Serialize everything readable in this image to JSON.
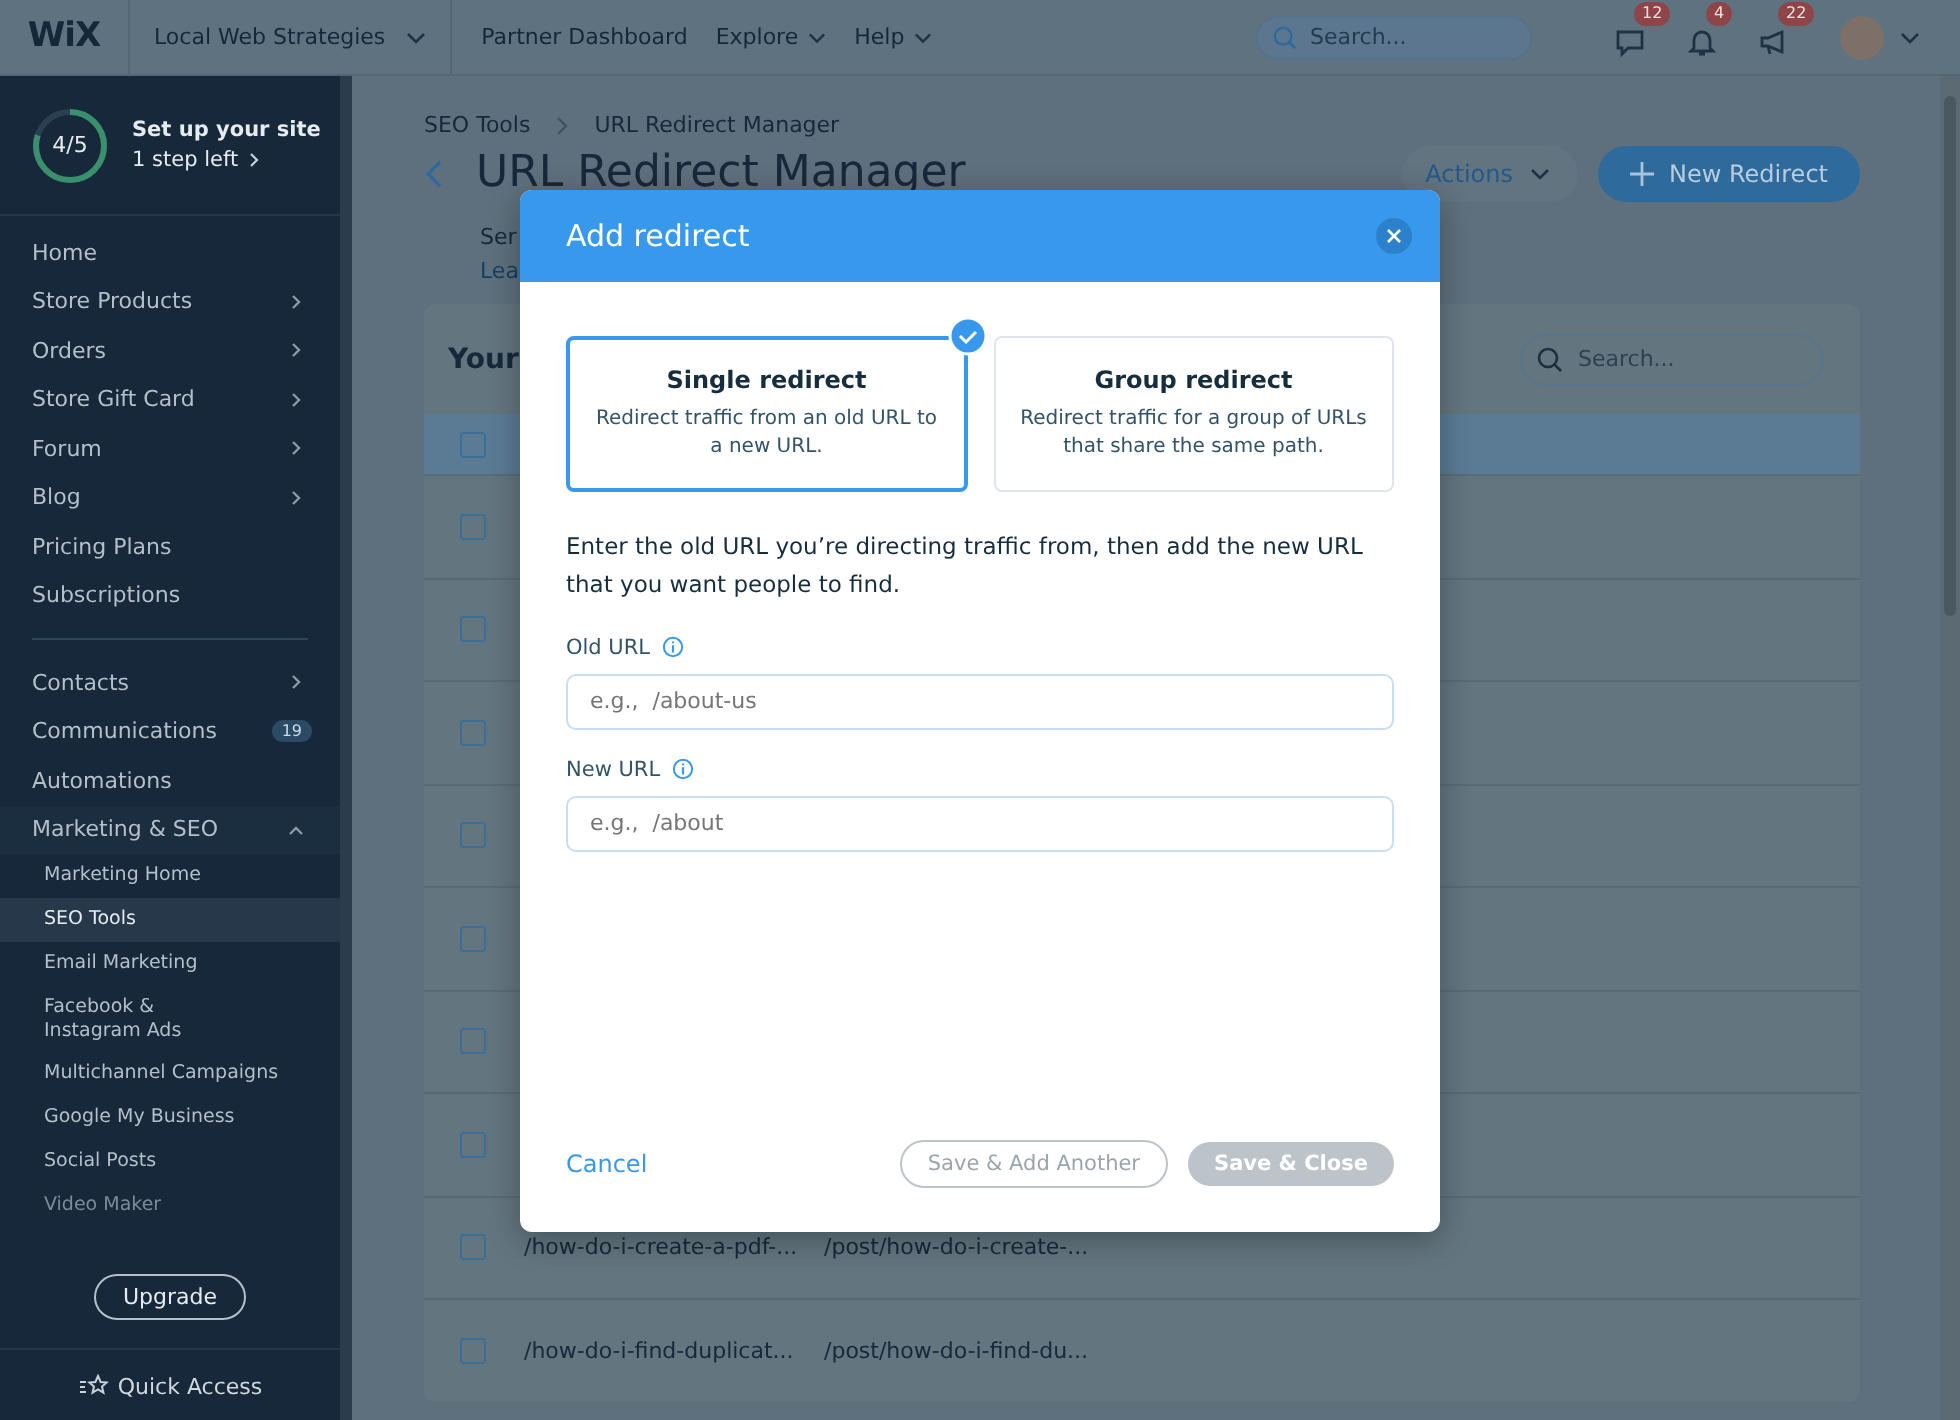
{
  "topbar": {
    "logo": "WiX",
    "site": "Local Web Strategies",
    "links": [
      {
        "label": "Partner Dashboard",
        "dropdown": false
      },
      {
        "label": "Explore",
        "dropdown": true
      },
      {
        "label": "Help",
        "dropdown": true
      }
    ],
    "search": {
      "placeholder": "Search..."
    },
    "notifications": [
      {
        "kind": "chat",
        "count": "12"
      },
      {
        "kind": "bell",
        "count": "4"
      },
      {
        "kind": "megaphone",
        "count": "22"
      }
    ]
  },
  "sidebar": {
    "setup": {
      "level": 0.8,
      "progress": "4/5",
      "title": "Set up your site",
      "subtitle": "1 step left"
    },
    "groups": [
      [
        {
          "label": "Home",
          "arrow": false
        },
        {
          "label": "Store Products",
          "arrow": true
        },
        {
          "label": "Orders",
          "arrow": true
        },
        {
          "label": "Store Gift Card",
          "arrow": true
        },
        {
          "label": "Forum",
          "arrow": true
        },
        {
          "label": "Blog",
          "arrow": true
        },
        {
          "label": "Pricing Plans",
          "arrow": false
        },
        {
          "label": "Subscriptions",
          "arrow": false
        }
      ],
      [
        {
          "label": "Contacts",
          "arrow": true
        },
        {
          "label": "Communications",
          "arrow": false,
          "badge": "19"
        },
        {
          "label": "Automations",
          "arrow": false
        },
        {
          "label": "Marketing & SEO",
          "arrow": true,
          "expanded": true,
          "children": [
            {
              "label": "Marketing Home",
              "selected": false
            },
            {
              "label": "SEO Tools",
              "selected": true
            },
            {
              "label": "Email Marketing",
              "selected": false
            },
            {
              "label": "Facebook &\nInstagram Ads",
              "selected": false
            },
            {
              "label": "Multichannel Campaigns",
              "selected": false
            },
            {
              "label": "Google My Business",
              "selected": false
            },
            {
              "label": "Social Posts",
              "selected": false
            },
            {
              "label": "Video Maker",
              "selected": false
            }
          ]
        }
      ]
    ],
    "upgrade": "Upgrade",
    "quick_access": "Quick Access"
  },
  "page": {
    "breadcrumbs": [
      "SEO Tools",
      "URL Redirect Manager"
    ],
    "title": "URL Redirect Manager",
    "subtitle": "Ser",
    "link": "Lea",
    "actions": "Actions",
    "new_button": "New Redirect",
    "table": {
      "title": "Your",
      "search": {
        "placeholder": "Search..."
      },
      "header": {
        "checked": false
      },
      "rows": [
        {
          "checked": false
        },
        {
          "checked": false
        },
        {
          "checked": false
        },
        {
          "checked": false
        },
        {
          "checked": false
        },
        {
          "checked": false
        },
        {
          "checked": false
        },
        {
          "checked": false,
          "from": "/how-do-i-create-a-pdf-...",
          "to": "/post/how-do-i-create-..."
        },
        {
          "checked": false,
          "from": "/how-do-i-find-duplicat...",
          "to": "/post/how-do-i-find-du..."
        }
      ]
    }
  },
  "modal": {
    "title": "Add redirect",
    "options": [
      {
        "title": "Single redirect",
        "description": "Redirect traffic from an old URL to a new URL.",
        "selected": true
      },
      {
        "title": "Group redirect",
        "description": "Redirect traffic for a group of URLs that share the same path.",
        "selected": false
      }
    ],
    "instructions": "Enter the old URL you’re directing traffic from, then add the new URL that you want people to find.",
    "fields": [
      {
        "label": "Old URL",
        "placeholder": "e.g.,  /about-us"
      },
      {
        "label": "New URL",
        "placeholder": "e.g.,  /about"
      }
    ],
    "cancel": "Cancel",
    "buttons": [
      {
        "label": "Save & Add Another",
        "kind": "outline",
        "disabled": true
      },
      {
        "label": "Save & Close",
        "kind": "filled",
        "disabled": true
      }
    ]
  }
}
